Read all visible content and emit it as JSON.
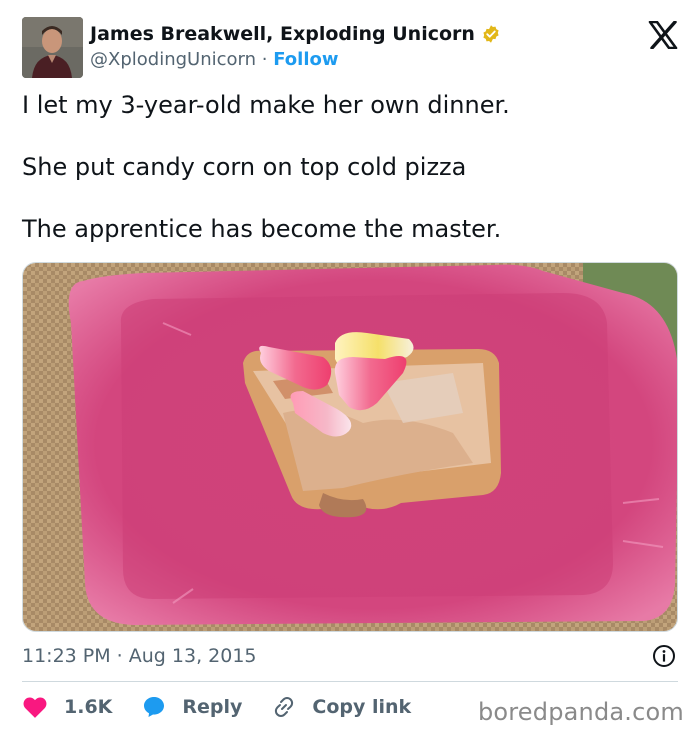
{
  "author": {
    "display_name": "James Breakwell, Exploding Unicorn",
    "handle": "@XplodingUnicorn",
    "separator": "·",
    "follow_label": "Follow",
    "verified_color": "#e2b719"
  },
  "tweet": {
    "lines": [
      "I let my 3-year-old make her own dinner.",
      "She put candy corn on top cold pizza",
      "The apprentice has become the master."
    ],
    "timestamp": "11:23 PM · Aug 13, 2015"
  },
  "actions": {
    "like_count": "1.6K",
    "reply_label": "Reply",
    "copy_link_label": "Copy link"
  },
  "colors": {
    "like": "#f91880",
    "reply": "#1d9bf0",
    "accent": "#1d9bf0",
    "plate": "#d8457f"
  },
  "icons": [
    "x-logo-icon",
    "verified-badge-icon",
    "info-icon",
    "heart-icon",
    "reply-bubble-icon",
    "link-icon"
  ],
  "watermark": "boredpanda.com"
}
